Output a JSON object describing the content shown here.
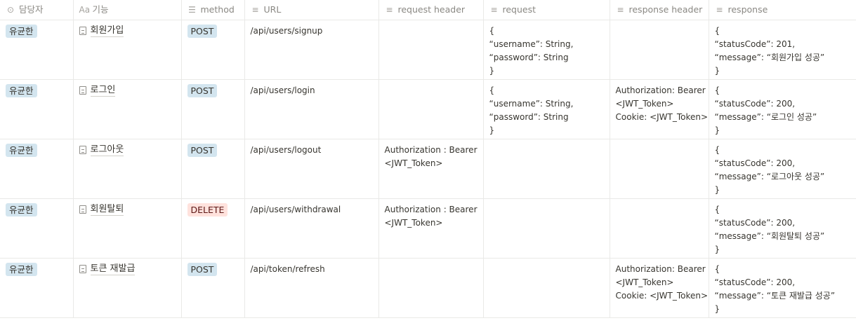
{
  "colors": {
    "assignee_tag_bg": "#d3e5ef",
    "post_bg": "#d3e5ef",
    "delete_bg": "#ffe2dd",
    "delete_text": "#5d1715"
  },
  "columns": [
    {
      "label": "담당자",
      "icon": "circle-dropdown-icon"
    },
    {
      "label": "기능",
      "icon": "title-aa-icon"
    },
    {
      "label": "method",
      "icon": "list-icon"
    },
    {
      "label": "URL",
      "icon": "text-lines-icon"
    },
    {
      "label": "request header",
      "icon": "text-lines-icon"
    },
    {
      "label": "request",
      "icon": "text-lines-icon"
    },
    {
      "label": "response header",
      "icon": "text-lines-icon"
    },
    {
      "label": "response",
      "icon": "text-lines-icon"
    }
  ],
  "rows": [
    {
      "assignee": "유균한",
      "feature": "회원가입",
      "method": "POST",
      "url": "/api/users/signup",
      "request_header": [],
      "request": [
        "{",
        "“username”: String,",
        "“password”: String",
        "}"
      ],
      "response_header": [],
      "response": [
        "{",
        "“statusCode”: 201,",
        "“message”: “회원가입 성공”",
        "}"
      ]
    },
    {
      "assignee": "유균한",
      "feature": "로그인",
      "method": "POST",
      "url": "/api/users/login",
      "request_header": [],
      "request": [
        "{",
        "“username”: String,",
        "“password”: String",
        "}"
      ],
      "response_header": [
        "Authorization: Bearer",
        "<JWT_Token>",
        "Cookie: <JWT_Token>"
      ],
      "response": [
        "{",
        "“statusCode”: 200,",
        "“message”: “로그인 성공”",
        "}"
      ]
    },
    {
      "assignee": "유균한",
      "feature": "로그아웃",
      "method": "POST",
      "url": "/api/users/logout",
      "request_header": [
        "Authorization : Bearer",
        "<JWT_Token>"
      ],
      "request": [],
      "response_header": [],
      "response": [
        "{",
        "“statusCode”: 200,",
        "“message”: “로그아웃 성공”",
        "}"
      ]
    },
    {
      "assignee": "유균한",
      "feature": "회원탈퇴",
      "method": "DELETE",
      "url": "/api/users/withdrawal",
      "request_header": [
        "Authorization : Bearer",
        "<JWT_Token>"
      ],
      "request": [],
      "response_header": [],
      "response": [
        "{",
        "“statusCode”: 200,",
        "“message”: “회원탈퇴 성공”",
        "}"
      ]
    },
    {
      "assignee": "유균한",
      "feature": "토큰 재발급",
      "method": "POST",
      "url": "/api/token/refresh",
      "request_header": [],
      "request": [],
      "response_header": [
        "Authorization: Bearer",
        "<JWT_Token>",
        "Cookie: <JWT_Token>"
      ],
      "response": [
        "{",
        "“statusCode”: 200,",
        "“message”: “토큰 재발급 성공”",
        "}"
      ]
    }
  ]
}
